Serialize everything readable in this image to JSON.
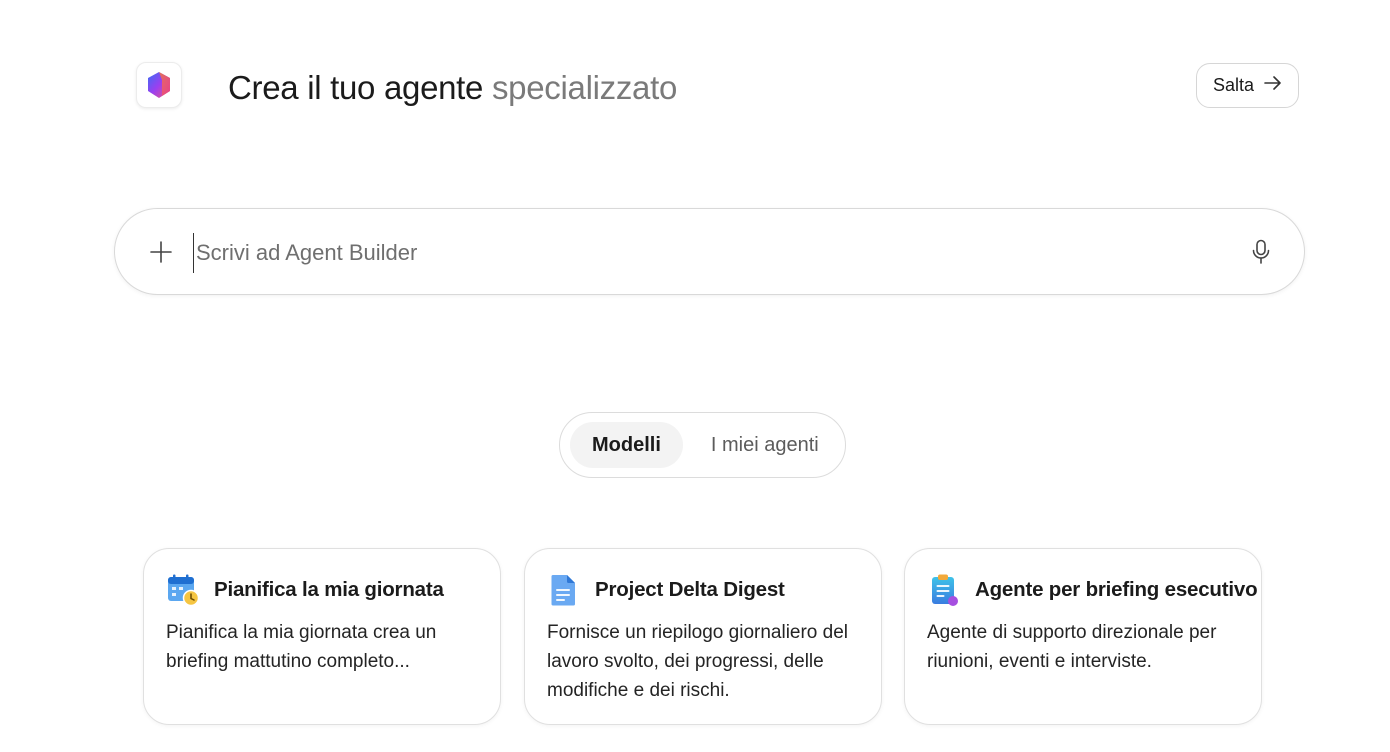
{
  "header": {
    "title_main": "Crea il tuo agente",
    "title_accent": "specializzato",
    "skip_label": "Salta",
    "logo_icon": "copilot-logo-icon",
    "skip_icon": "arrow-right-icon"
  },
  "prompt": {
    "placeholder": "Scrivi ad Agent Builder",
    "value": "",
    "add_icon": "plus-icon",
    "mic_icon": "microphone-icon"
  },
  "tabs": [
    {
      "label": "Modelli",
      "active": true
    },
    {
      "label": "I miei agenti",
      "active": false
    }
  ],
  "cards": [
    {
      "title": "Pianifica la mia giornata",
      "description": "Pianifica la mia giornata crea un briefing mattutino completo...",
      "icon": "calendar-clock-icon"
    },
    {
      "title": "Project Delta Digest",
      "description": "Fornisce un riepilogo giornaliero del lavoro svolto, dei progressi, delle modifiche e dei rischi.",
      "icon": "document-icon"
    },
    {
      "title": "Agente per briefing esecutivo",
      "description": "Agente di supporto direzionale per riunioni, eventi e interviste.",
      "icon": "clipboard-icon"
    }
  ],
  "colors": {
    "text": "#1b1b1b",
    "muted": "#7a7a7a",
    "border": "#d9d9d9",
    "active_tab_bg": "#f3f3f3"
  }
}
